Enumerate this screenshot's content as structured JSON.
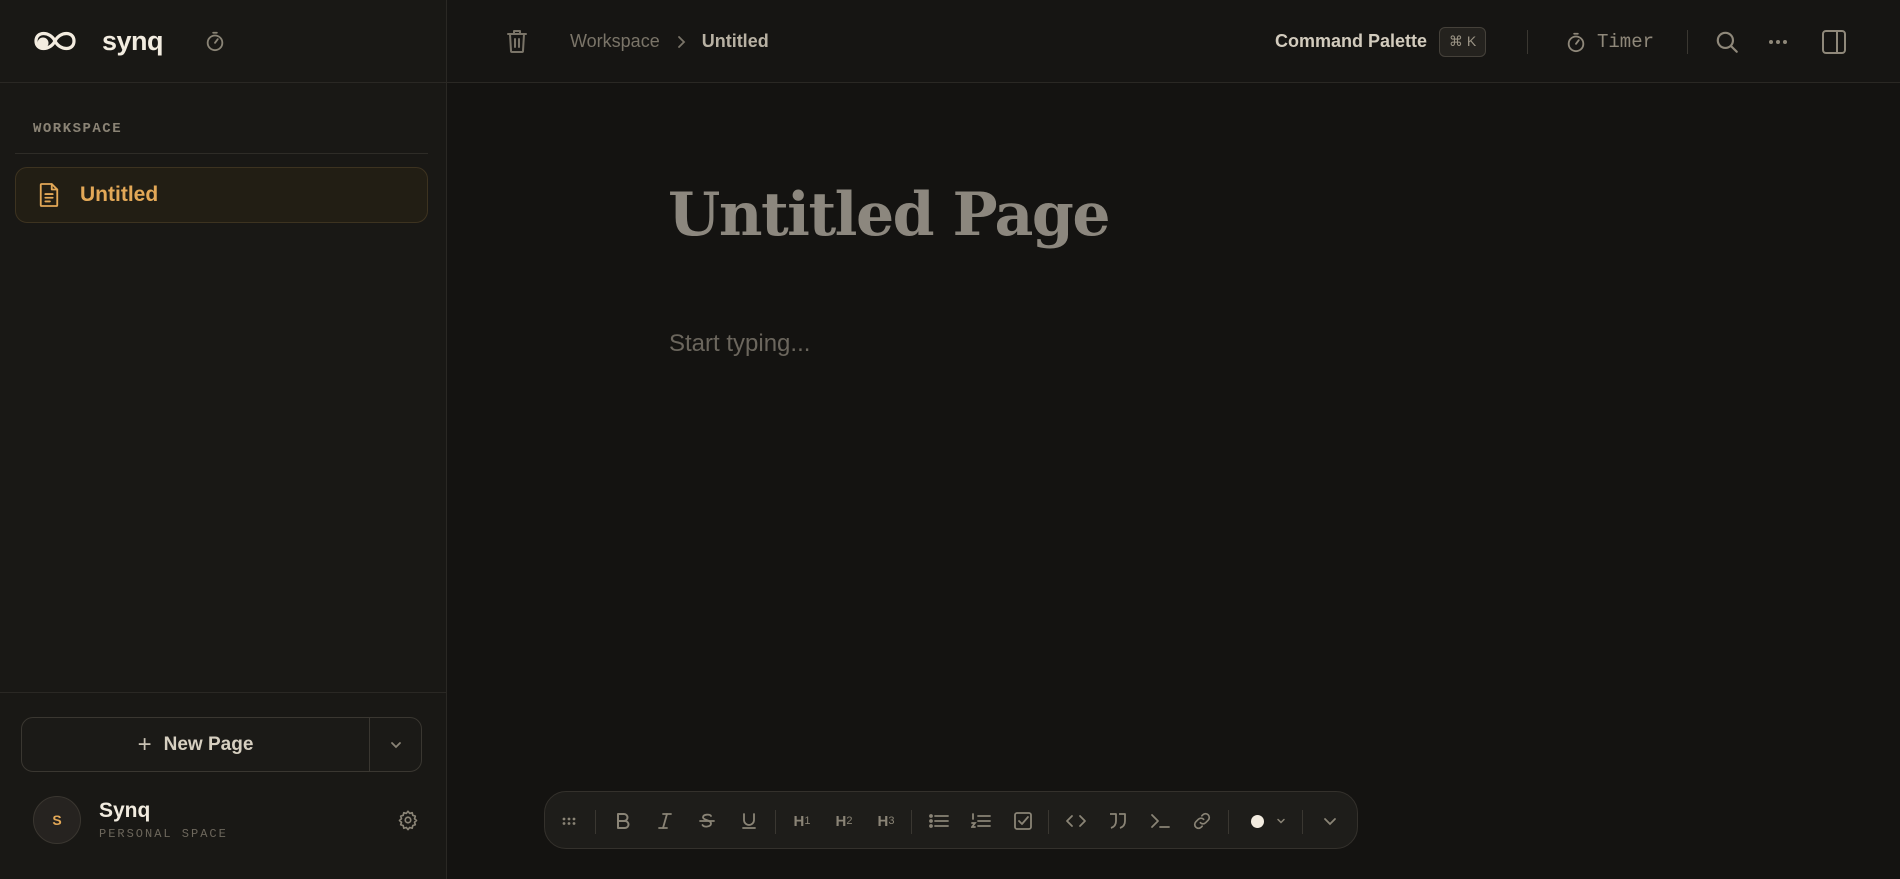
{
  "app": {
    "brand": "synq"
  },
  "sidebar": {
    "section_label": "WORKSPACE",
    "pages": [
      {
        "label": "Untitled",
        "icon": "document-icon",
        "active": true
      }
    ],
    "new_page_label": "New Page",
    "user": {
      "initial": "S",
      "name": "Synq",
      "subtitle": "PERSONAL SPACE"
    }
  },
  "topbar": {
    "breadcrumb": [
      "Workspace",
      "Untitled"
    ],
    "command_palette_label": "Command Palette",
    "command_palette_shortcut": "⌘ K",
    "timer_label": "Timer"
  },
  "editor": {
    "title": "Untitled Page",
    "placeholder": "Start typing..."
  },
  "format_toolbar": {
    "headings": [
      "H1",
      "H2",
      "H3"
    ],
    "text_color": "#f3ece0"
  },
  "colors": {
    "accent": "#e3a857",
    "background": "#141311",
    "sidebar": "#191815"
  }
}
